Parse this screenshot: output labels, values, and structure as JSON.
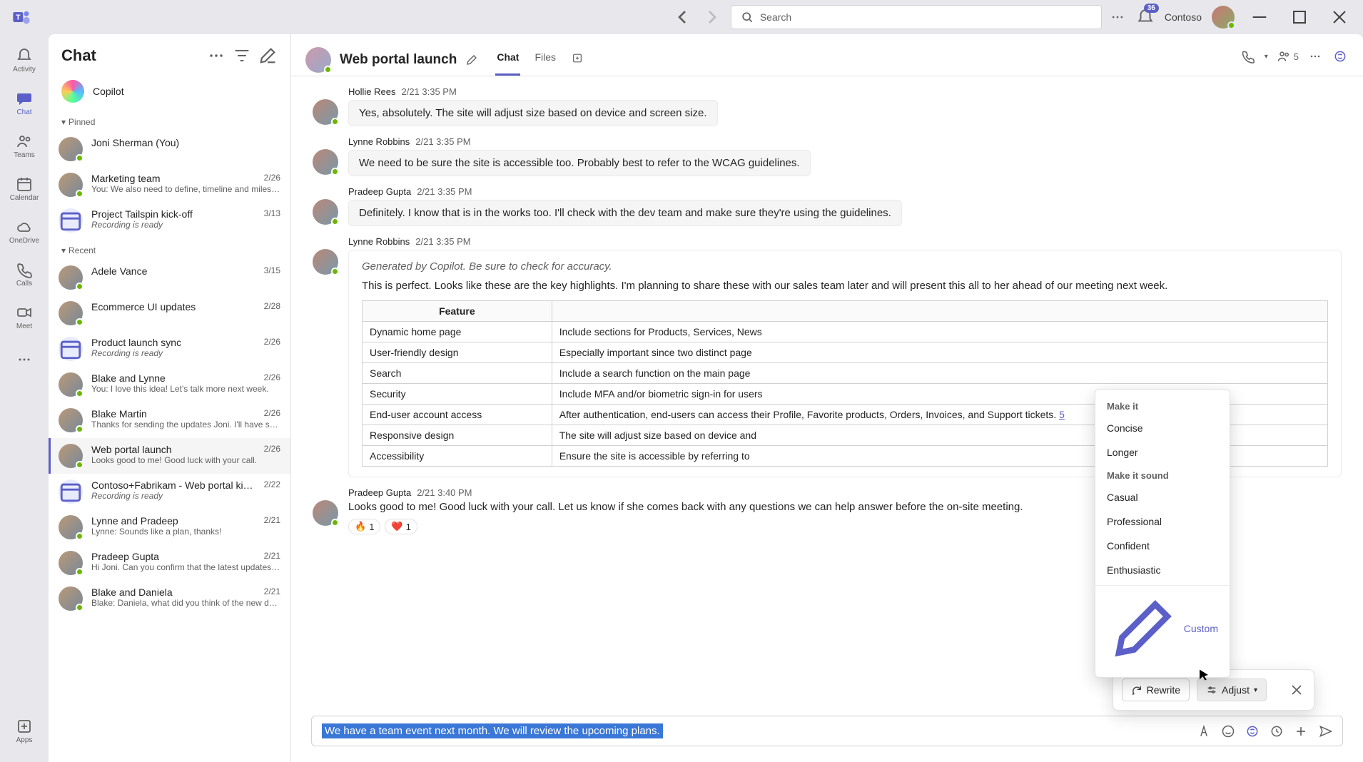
{
  "titlebar": {
    "search_placeholder": "Search",
    "org": "Contoso",
    "notif_badge": "36"
  },
  "apprail": [
    {
      "key": "activity",
      "label": "Activity"
    },
    {
      "key": "chat",
      "label": "Chat"
    },
    {
      "key": "teams",
      "label": "Teams"
    },
    {
      "key": "calendar",
      "label": "Calendar"
    },
    {
      "key": "onedrive",
      "label": "OneDrive"
    },
    {
      "key": "calls",
      "label": "Calls"
    },
    {
      "key": "meet",
      "label": "Meet"
    }
  ],
  "apprail_apps": "Apps",
  "chatlist": {
    "title": "Chat",
    "copilot": "Copilot",
    "section_pinned": "Pinned",
    "section_recent": "Recent",
    "pinned": [
      {
        "name": "Joni Sherman (You)",
        "date": "",
        "preview": ""
      },
      {
        "name": "Marketing team",
        "date": "2/26",
        "preview": "You: We also need to define, timeline and miles…"
      },
      {
        "name": "Project Tailspin kick-off",
        "date": "3/13",
        "preview": "Recording is ready",
        "italic": true,
        "cal": true
      }
    ],
    "recent": [
      {
        "name": "Adele Vance",
        "date": "3/15",
        "preview": ""
      },
      {
        "name": "Ecommerce UI updates",
        "date": "2/28",
        "preview": ""
      },
      {
        "name": "Product launch sync",
        "date": "2/26",
        "preview": "Recording is ready",
        "italic": true,
        "cal": true
      },
      {
        "name": "Blake and Lynne",
        "date": "2/26",
        "preview": "You: I love this idea! Let's talk more next week."
      },
      {
        "name": "Blake Martin",
        "date": "2/26",
        "preview": "Thanks for sending the updates Joni. I'll have s…"
      },
      {
        "name": "Web portal launch",
        "date": "2/26",
        "preview": "Looks good to me! Good luck with your call.",
        "selected": true
      },
      {
        "name": "Contoso+Fabrikam - Web portal ki…",
        "date": "2/22",
        "preview": "Recording is ready",
        "italic": true,
        "cal": true
      },
      {
        "name": "Lynne and Pradeep",
        "date": "2/21",
        "preview": "Lynne: Sounds like a plan, thanks!"
      },
      {
        "name": "Pradeep Gupta",
        "date": "2/21",
        "preview": "Hi Joni. Can you confirm that the latest updates…"
      },
      {
        "name": "Blake and Daniela",
        "date": "2/21",
        "preview": "Blake: Daniela, what did you think of the new d…"
      }
    ]
  },
  "chat": {
    "title": "Web portal launch",
    "tabs": {
      "chat": "Chat",
      "files": "Files"
    },
    "people_count": "5",
    "messages": [
      {
        "sender": "Hollie Rees",
        "ts": "2/21 3:35 PM",
        "text": "Yes, absolutely. The site will adjust size based on device and screen size."
      },
      {
        "sender": "Lynne Robbins",
        "ts": "2/21 3:35 PM",
        "text": "We need to be sure the site is accessible too. Probably best to refer to the WCAG guidelines."
      },
      {
        "sender": "Pradeep Gupta",
        "ts": "2/21 3:35 PM",
        "text": "Definitely. I know that is in the works too. I'll check with the dev team and make sure they're using the guidelines."
      }
    ],
    "copilot_msg": {
      "sender": "Lynne Robbins",
      "ts": "2/21 3:35 PM",
      "gen": "Generated by Copilot. Be sure to check for accuracy.",
      "intro": "This is perfect. Looks like these are the key highlights. I'm planning to share these with our sales team later and will present this all to her ahead of our meeting next week.",
      "th_feature": "Feature",
      "th_desc": "",
      "rows": [
        {
          "f": "Dynamic home page",
          "d": "Include sections for Products, Services, News"
        },
        {
          "f": "User-friendly design",
          "d": "Especially important since two distinct page"
        },
        {
          "f": "Search",
          "d": "Include a search function on the main page"
        },
        {
          "f": "Security",
          "d": "Include MFA and/or biometric sign-in for users"
        },
        {
          "f": "End-user account access",
          "d": "After authentication, end-users can access their Profile, Favorite products, Orders, Invoices, and Support tickets.",
          "link": "5"
        },
        {
          "f": "Responsive design",
          "d": "The site will adjust size based on device and"
        },
        {
          "f": "Accessibility",
          "d": "Ensure the site is accessible by referring to"
        }
      ]
    },
    "last_msg": {
      "sender": "Pradeep Gupta",
      "ts": "2/21 3:40 PM",
      "text": "Looks good to me! Good luck with your call. Let us know if she comes back with any questions we can help answer before the on-site meeting.",
      "react_fire": "1",
      "react_heart": "1"
    }
  },
  "copilot_panel": {
    "rewrite": "Rewrite",
    "adjust": "Adjust"
  },
  "adjust_menu": {
    "sect1": "Make it",
    "concise": "Concise",
    "longer": "Longer",
    "sect2": "Make it sound",
    "casual": "Casual",
    "professional": "Professional",
    "confident": "Confident",
    "enthusiastic": "Enthusiastic",
    "custom": "Custom"
  },
  "compose": {
    "text": "We have a team event next month. We will review the upcoming plans."
  }
}
